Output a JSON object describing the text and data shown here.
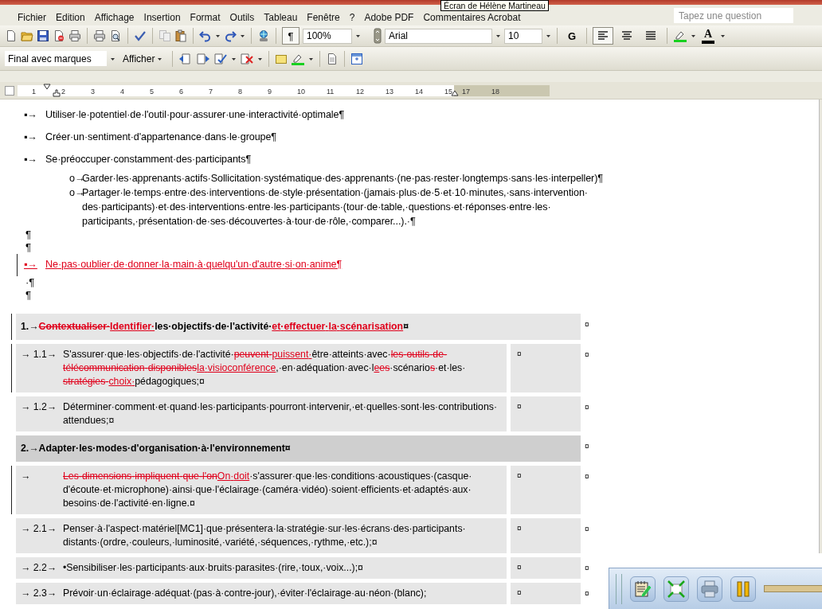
{
  "tooltip": "Écran de Hélène Martineau",
  "menu": [
    "Fichier",
    "Edition",
    "Affichage",
    "Insertion",
    "Format",
    "Outils",
    "Tableau",
    "Fenêtre",
    "?",
    "Adobe PDF",
    "Commentaires Acrobat"
  ],
  "search": {
    "placeholder": "Tapez une question"
  },
  "toolbar_standard": {
    "pilcrow": {
      "label": "¶",
      "pressed": true
    },
    "zoom": "100%",
    "font": "Arial",
    "font_size": "10",
    "bold": {
      "label": "G",
      "pressed": false
    },
    "alignment": [
      {
        "selected": true
      },
      {
        "selected": false
      },
      {
        "selected": false
      }
    ],
    "font_color_label": "A"
  },
  "toolbar_reviewing": {
    "display_mode": "Final avec marques",
    "show_menu": "Afficher"
  },
  "ruler": [
    "1",
    "2",
    "3",
    "4",
    "5",
    "6",
    "7",
    "8",
    "9",
    "10",
    "11",
    "12",
    "13",
    "14",
    "15",
    "17",
    "18"
  ],
  "document": {
    "blocks": [
      {
        "kind": "bullet",
        "marker": "▪→",
        "changed": false,
        "runs": [
          {
            "text": "Utiliser·le·potentiel·de·l'outil·pour·assurer·une·interactivité·optimale¶",
            "kind": "plain"
          }
        ]
      },
      {
        "kind": "bullet",
        "marker": "▪→",
        "changed": false,
        "runs": [
          {
            "text": "Créer·un·sentiment·d'appartenance·dans·le·groupe¶",
            "kind": "plain"
          }
        ]
      },
      {
        "kind": "bullet",
        "marker": "▪→",
        "changed": false,
        "runs": [
          {
            "text": "Se·préoccuper·constamment·des·participants¶",
            "kind": "plain"
          }
        ],
        "children": [
          {
            "kind": "bullet",
            "marker": "o→",
            "changed": false,
            "runs": [
              {
                "text": "Garder·les·apprenants·actifs·Sollicitation·systématique·des·apprenants·(ne·pas·rester·longtemps·sans·les·interpeller)¶",
                "kind": "plain"
              }
            ]
          },
          {
            "kind": "bullet",
            "marker": "o→",
            "changed": false,
            "runs": [
              {
                "text": "Partager·le·temps·entre·des·interventions·de·style·présentation·(jamais·plus·de·5·et·10·minutes,·sans·intervention·des·participants)·et·des·interventions·entre·les·participants·(tour·de·table,·questions·et·réponses·entre·les·participants,·présentation·de·ses·découvertes·à·tour·de·rôle,·comparer...).·¶",
                "kind": "plain"
              }
            ]
          }
        ]
      },
      {
        "kind": "mark",
        "text": "¶"
      },
      {
        "kind": "mark",
        "text": "¶"
      },
      {
        "kind": "bullet",
        "marker": "▪→",
        "changed": true,
        "runs": [
          {
            "text": "Ne·pas·oublier·de·donner·la·main·à·quelqu'un·d'autre·si·on·anime¶",
            "kind": "inserted"
          }
        ]
      },
      {
        "kind": "mark",
        "text": "·¶"
      },
      {
        "kind": "mark",
        "text": "¶"
      }
    ]
  },
  "table": {
    "rows": [
      {
        "kind": "heading",
        "shaded": false,
        "changed": true,
        "end_mark": "¤",
        "runs": [
          {
            "text": "1.→",
            "kind": "plain"
          },
          {
            "text": "Contextualiser·",
            "kind": "deleted"
          },
          {
            "text": "Identifier·",
            "kind": "inserted"
          },
          {
            "text": "les·objectifs·de·l'activité·",
            "kind": "plain"
          },
          {
            "text": "et·effectuer·la·scénarisation",
            "kind": "inserted"
          },
          {
            "text": "¤",
            "kind": "plain"
          }
        ]
      },
      {
        "kind": "item",
        "marker": "→ 1.1→",
        "changed": true,
        "cell_2": "¤",
        "end_mark": "¤",
        "runs": [
          {
            "text": "S'assurer·que·les·objectifs·de·l'activité·",
            "kind": "plain"
          },
          {
            "text": "peuvent·",
            "kind": "deleted"
          },
          {
            "text": "puissent·",
            "kind": "inserted"
          },
          {
            "text": "être·atteints·avec·",
            "kind": "plain"
          },
          {
            "text": "les·outils·de·télécommunication·disponibles",
            "kind": "deleted"
          },
          {
            "text": "la·visioconférence",
            "kind": "inserted"
          },
          {
            "text": ",·en·adéquation·avec·l",
            "kind": "plain"
          },
          {
            "text": "e",
            "kind": "inserted"
          },
          {
            "text": "es",
            "kind": "deleted"
          },
          {
            "text": "·scénario",
            "kind": "plain"
          },
          {
            "text": "s",
            "kind": "deleted"
          },
          {
            "text": "·et·les·",
            "kind": "plain"
          },
          {
            "text": "stratégies·",
            "kind": "deleted"
          },
          {
            "text": "choix·",
            "kind": "inserted"
          },
          {
            "text": "pédagogiques;¤",
            "kind": "plain"
          }
        ]
      },
      {
        "kind": "item",
        "marker": "→ 1.2→",
        "changed": false,
        "cell_2": "¤",
        "end_mark": "¤",
        "runs": [
          {
            "text": "Déterminer·comment·et·quand·les·participants·pourront·intervenir,·et·quelles·sont·les·contributions·attendues;¤",
            "kind": "plain"
          }
        ]
      },
      {
        "kind": "heading",
        "shaded": true,
        "changed": false,
        "end_mark": "¤",
        "runs": [
          {
            "text": "2.→Adapter·les·modes·d'organisation·à·l'environnement¤",
            "kind": "plain"
          }
        ]
      },
      {
        "kind": "item",
        "marker": "→",
        "changed": true,
        "cell_2": "¤",
        "end_mark": "¤",
        "runs": [
          {
            "text": "Les·dimensions·impliquent·que·l'on",
            "kind": "deleted"
          },
          {
            "text": "On·doit",
            "kind": "inserted"
          },
          {
            "text": "·s'assurer·que·les·conditions·acoustiques·(casque·d'écoute·et·microphone)·ainsi·que·l'éclairage·(caméra·vidéo)·soient·efficients·et·adaptés·aux·besoins·de·l'activité·en·ligne.¤",
            "kind": "plain"
          }
        ]
      },
      {
        "kind": "item",
        "marker": "→ 2.1→",
        "changed": false,
        "cell_2": "¤",
        "end_mark": "¤",
        "runs": [
          {
            "text": "Penser·à·l'aspect·matériel[MC1]·que·présentera·la·stratégie·sur·les·écrans·des·participants·distants·(ordre,·couleurs,·luminosité,·variété,·séquences,·rythme,·etc.);¤",
            "kind": "plain"
          }
        ]
      },
      {
        "kind": "item",
        "marker": "→ 2.2→",
        "changed": false,
        "cell_2": "¤",
        "end_mark": "¤",
        "runs": [
          {
            "text": "•Sensibiliser·les·participants·aux·bruits·parasites·(rire,·toux,·voix...);¤",
            "kind": "plain"
          }
        ]
      },
      {
        "kind": "item",
        "marker": "→ 2.3→",
        "changed": false,
        "cell_2": "¤",
        "end_mark": "¤",
        "runs": [
          {
            "text": "Prévoir·un·éclairage·adéquat·(pas·à·contre-jour),·éviter·l'éclairage·au·néon·(blanc);",
            "kind": "plain"
          }
        ]
      }
    ]
  }
}
